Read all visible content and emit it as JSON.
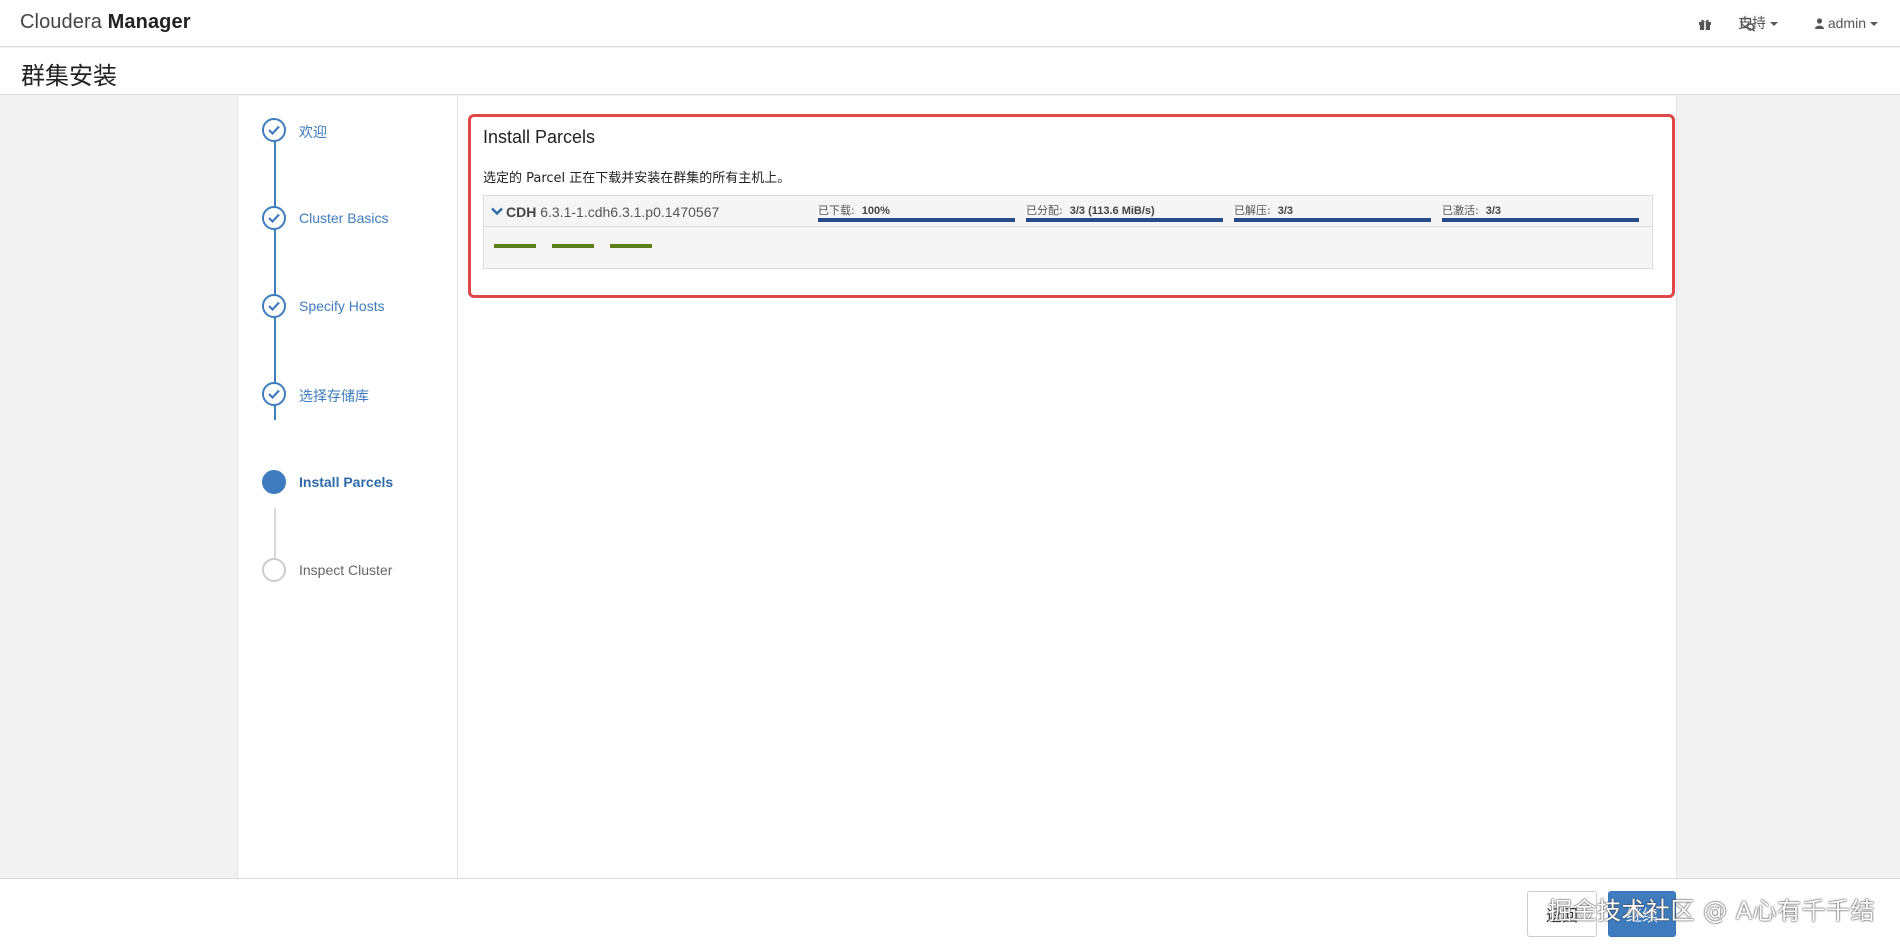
{
  "app": {
    "brand_light": "Cloudera",
    "brand_bold": "Manager"
  },
  "nav": {
    "gift_icon": "gift-icon",
    "support_icon": "support-icon",
    "support_label": "支持",
    "user_label": "admin"
  },
  "page": {
    "title": "群集安装"
  },
  "steps": [
    {
      "label": "欢迎",
      "state": "done"
    },
    {
      "label": "Cluster Basics",
      "state": "done"
    },
    {
      "label": "Specify Hosts",
      "state": "done"
    },
    {
      "label": "选择存储库",
      "state": "done"
    },
    {
      "label": "Install Parcels",
      "state": "active"
    },
    {
      "label": "Inspect Cluster",
      "state": "pending"
    }
  ],
  "panel": {
    "title": "Install Parcels",
    "description": "选定的 Parcel 正在下载并安装在群集的所有主机上。",
    "parcel": {
      "name": "CDH",
      "version": "6.3.1-1.cdh6.3.1.p0.1470567",
      "stats": [
        {
          "label": "已下载:",
          "value": "100%",
          "progress": 1.0
        },
        {
          "label": "已分配:",
          "value": "3/3 (113.6 MiB/s)",
          "progress": 1.0
        },
        {
          "label": "已解压:",
          "value": "3/3",
          "progress": 1.0
        },
        {
          "label": "已激活:",
          "value": "3/3",
          "progress": 1.0
        }
      ],
      "host_count": 3
    }
  },
  "footer": {
    "back_label": "返回",
    "next_label": "继续",
    "watermark": "掘金技术社区 @ A心有千千结"
  },
  "colors": {
    "accent": "#3f7cbf",
    "highlight_border": "#e04848",
    "stat_bar": "#274a8c",
    "host_bar": "#5d7f1c"
  }
}
